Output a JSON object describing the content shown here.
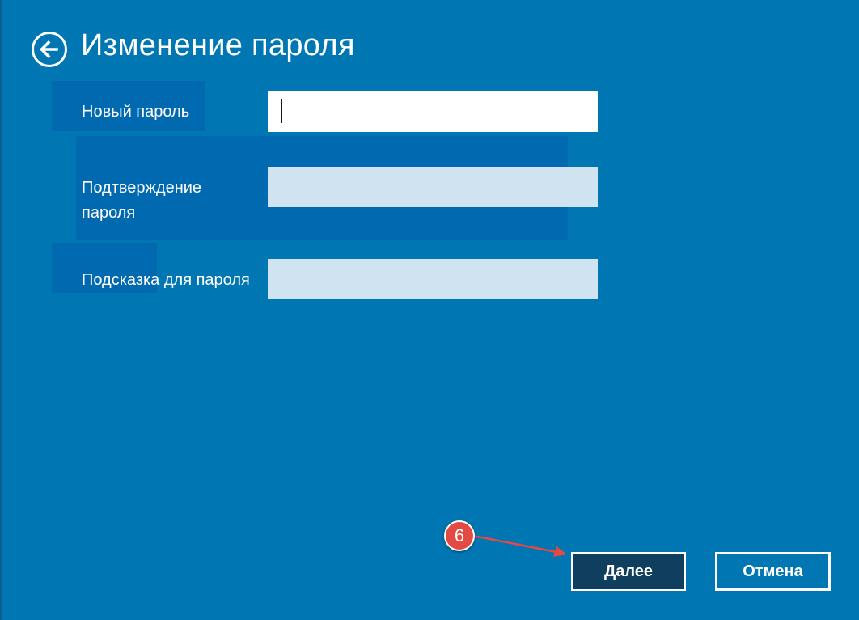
{
  "header": {
    "title": "Изменение пароля",
    "back_icon": "back-arrow-circle-icon"
  },
  "form": {
    "fields": [
      {
        "label": "Новый пароль",
        "value": "",
        "state": "focused"
      },
      {
        "label": "Подтверждение пароля",
        "value": "",
        "state": "inactive"
      },
      {
        "label": "Подсказка для пароля",
        "value": "",
        "state": "inactive"
      }
    ]
  },
  "footer": {
    "next_label": "Далее",
    "cancel_label": "Отмена"
  },
  "annotation": {
    "step_number": "6",
    "color": "#e34a44"
  },
  "colors": {
    "background": "#0076b2",
    "primary_button": "#0f3e5f",
    "input_active": "#ffffff",
    "input_inactive": "#cfe3f0"
  }
}
